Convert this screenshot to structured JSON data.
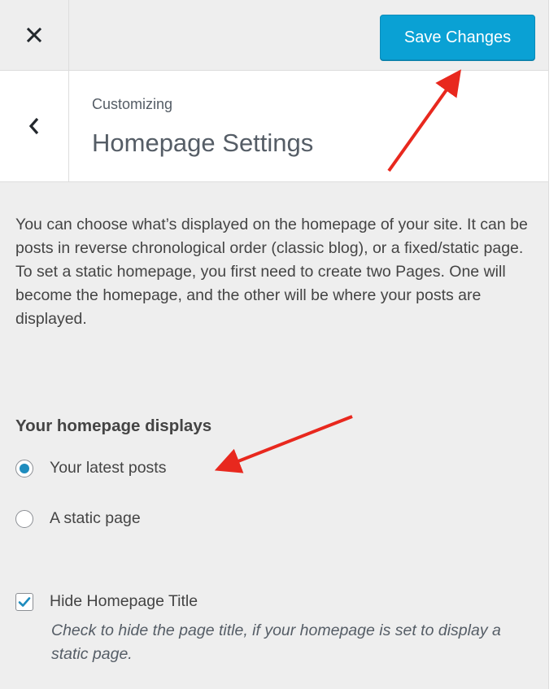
{
  "header": {
    "close_icon": "close-icon",
    "save_label": "Save Changes",
    "accent_color": "#0aa1d4"
  },
  "section": {
    "back_icon": "chevron-left-icon",
    "breadcrumb": "Customizing",
    "title": "Homepage Settings"
  },
  "description": "You can choose what’s displayed on the homepage of your site. It can be posts in reverse chronological order (classic blog), or a fixed/static page. To set a static homepage, you first need to create two Pages. One will become the homepage, and the other will be where your posts are displayed.",
  "homepage_displays": {
    "label": "Your homepage displays",
    "options": [
      {
        "label": "Your latest posts",
        "selected": true
      },
      {
        "label": "A static page",
        "selected": false
      }
    ]
  },
  "hide_title": {
    "label": "Hide Homepage Title",
    "checked": true,
    "description": "Check to hide the page title, if your homepage is set to display a static page."
  },
  "annotations": {
    "arrow_color": "#e8281e",
    "arrow_icon": "red-arrow-annotation"
  }
}
